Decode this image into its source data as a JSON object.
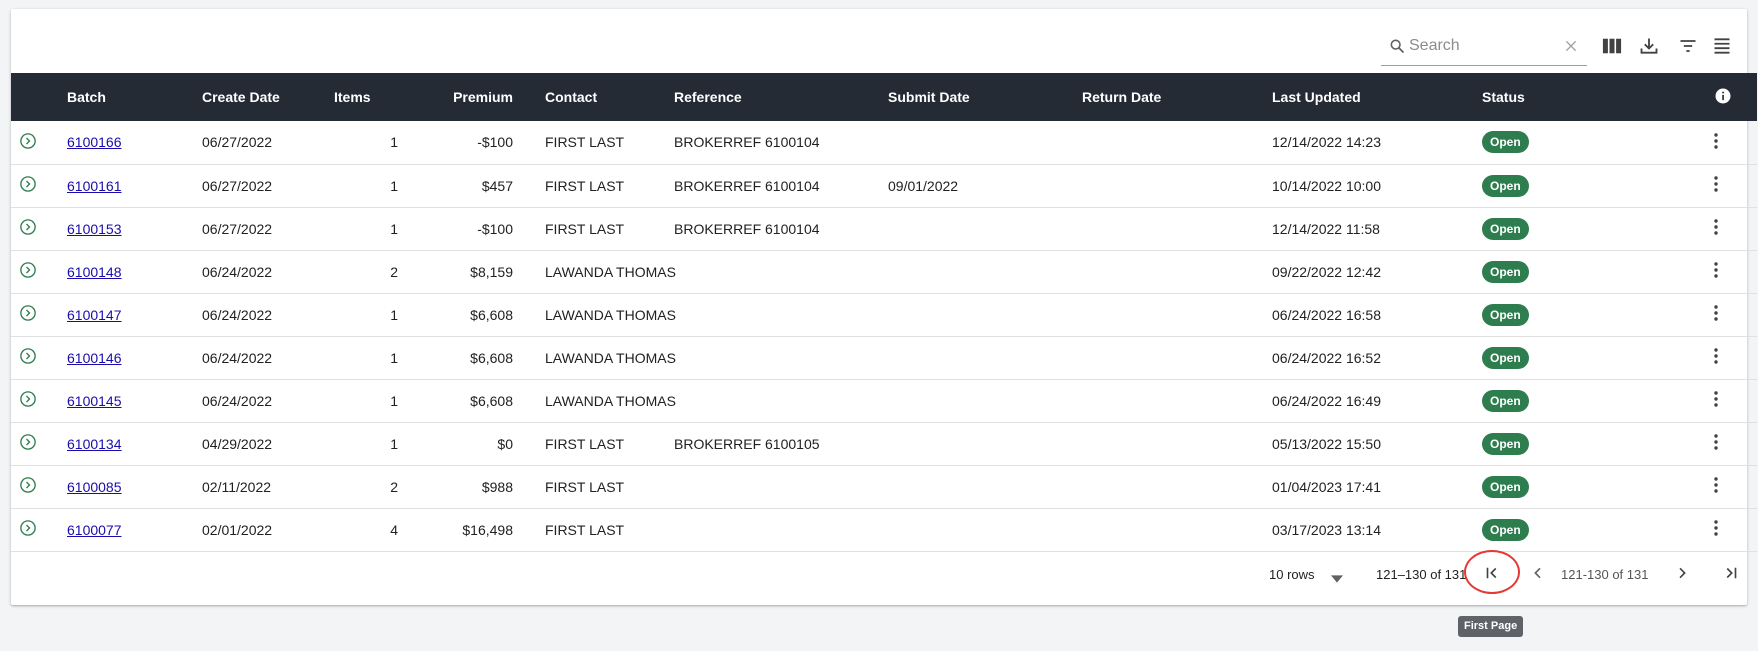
{
  "search": {
    "placeholder": "Search",
    "value": ""
  },
  "toolbar_icons": [
    "search-icon",
    "clear-icon",
    "columns-icon",
    "download-icon",
    "filter-icon",
    "density-icon"
  ],
  "table": {
    "columns": [
      "",
      "Batch",
      "Create Date",
      "Items",
      "Premium",
      "Contact",
      "Reference",
      "Submit Date",
      "Return Date",
      "Last Updated",
      "Status",
      ""
    ],
    "rows": [
      {
        "batch": "6100166",
        "create_date": "06/27/2022",
        "items": "1",
        "premium": "-$100",
        "contact": "FIRST LAST",
        "reference": "BROKERREF 6100104",
        "submit_date": "",
        "return_date": "",
        "last_updated": "12/14/2022 14:23",
        "status": "Open"
      },
      {
        "batch": "6100161",
        "create_date": "06/27/2022",
        "items": "1",
        "premium": "$457",
        "contact": "FIRST LAST",
        "reference": "BROKERREF 6100104",
        "submit_date": "09/01/2022",
        "return_date": "",
        "last_updated": "10/14/2022 10:00",
        "status": "Open"
      },
      {
        "batch": "6100153",
        "create_date": "06/27/2022",
        "items": "1",
        "premium": "-$100",
        "contact": "FIRST LAST",
        "reference": "BROKERREF 6100104",
        "submit_date": "",
        "return_date": "",
        "last_updated": "12/14/2022 11:58",
        "status": "Open"
      },
      {
        "batch": "6100148",
        "create_date": "06/24/2022",
        "items": "2",
        "premium": "$8,159",
        "contact": "LAWANDA THOMAS",
        "reference": "",
        "submit_date": "",
        "return_date": "",
        "last_updated": "09/22/2022 12:42",
        "status": "Open"
      },
      {
        "batch": "6100147",
        "create_date": "06/24/2022",
        "items": "1",
        "premium": "$6,608",
        "contact": "LAWANDA THOMAS",
        "reference": "",
        "submit_date": "",
        "return_date": "",
        "last_updated": "06/24/2022 16:58",
        "status": "Open"
      },
      {
        "batch": "6100146",
        "create_date": "06/24/2022",
        "items": "1",
        "premium": "$6,608",
        "contact": "LAWANDA THOMAS",
        "reference": "",
        "submit_date": "",
        "return_date": "",
        "last_updated": "06/24/2022 16:52",
        "status": "Open"
      },
      {
        "batch": "6100145",
        "create_date": "06/24/2022",
        "items": "1",
        "premium": "$6,608",
        "contact": "LAWANDA THOMAS",
        "reference": "",
        "submit_date": "",
        "return_date": "",
        "last_updated": "06/24/2022 16:49",
        "status": "Open"
      },
      {
        "batch": "6100134",
        "create_date": "04/29/2022",
        "items": "1",
        "premium": "$0",
        "contact": "FIRST LAST",
        "reference": "BROKERREF 6100105",
        "submit_date": "",
        "return_date": "",
        "last_updated": "05/13/2022 15:50",
        "status": "Open"
      },
      {
        "batch": "6100085",
        "create_date": "02/11/2022",
        "items": "2",
        "premium": "$988",
        "contact": "FIRST LAST",
        "reference": "",
        "submit_date": "",
        "return_date": "",
        "last_updated": "01/04/2023 17:41",
        "status": "Open"
      },
      {
        "batch": "6100077",
        "create_date": "02/01/2022",
        "items": "4",
        "premium": "$16,498",
        "contact": "FIRST LAST",
        "reference": "",
        "submit_date": "",
        "return_date": "",
        "last_updated": "03/17/2023 13:14",
        "status": "Open"
      }
    ]
  },
  "pagination": {
    "rows_label": "10 rows",
    "range_text": "121–130 of 131",
    "range_text_right": "121-130 of 131",
    "tooltip": "First Page"
  },
  "colors": {
    "header_bg": "#252b35",
    "status_badge": "#2e7d4f",
    "link": "#1a0dab",
    "highlight": "#e53935"
  }
}
